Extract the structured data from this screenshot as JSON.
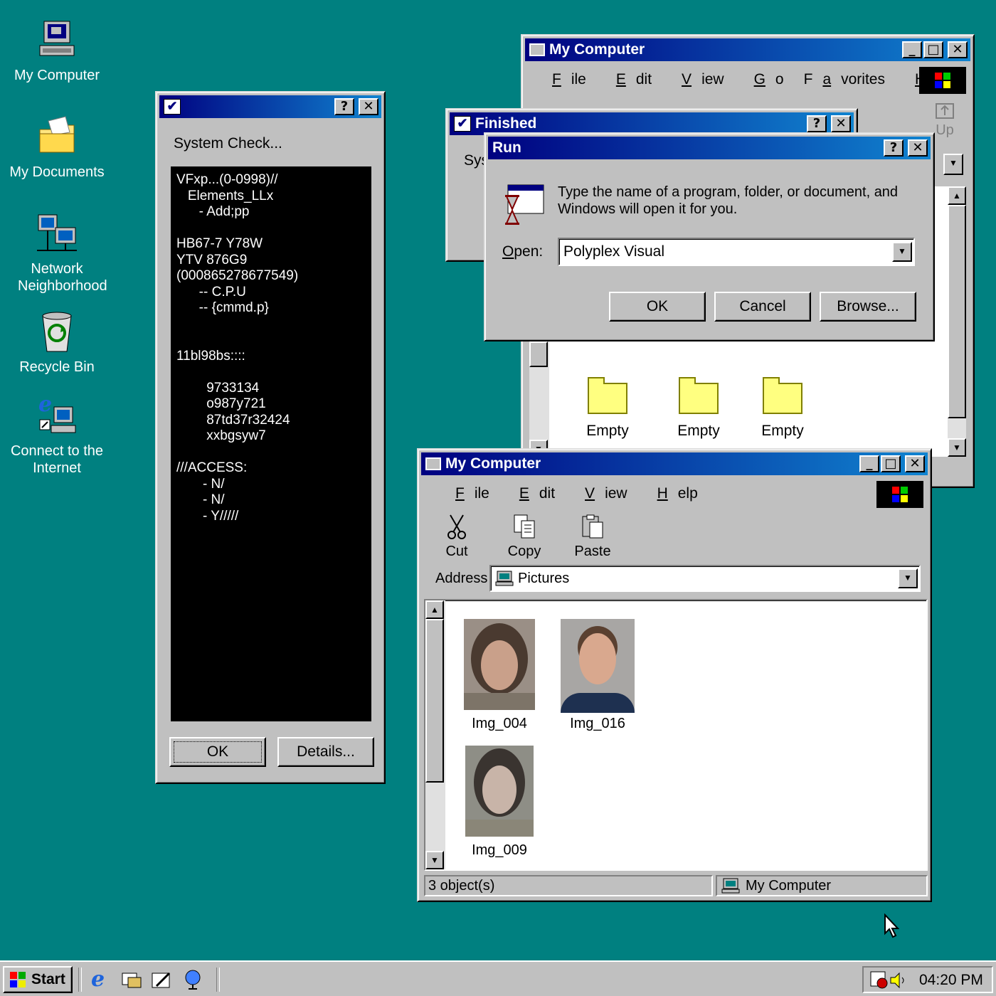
{
  "desktop": {
    "icons": [
      {
        "label": "My Computer"
      },
      {
        "label": "My Documents"
      },
      {
        "label": "Network Neighborhood"
      },
      {
        "label": "Recycle Bin"
      },
      {
        "label": "Connect to the Internet"
      }
    ]
  },
  "system_check": {
    "heading": "System Check...",
    "console_lines": [
      "VFxp...(0-0998)//",
      "   Elements_LLx",
      "      - Add;pp",
      "",
      "HB67-7 Y78W",
      "YTV 876G9",
      "(000865278677549)",
      "      -- C.P.U",
      "      -- {cmmd.p}",
      "",
      "",
      "11bl98bs::::",
      "",
      "        9733134",
      "        o987y721",
      "        87td37r32424",
      "        xxbgsyw7",
      "",
      "///ACCESS:",
      "       - N/",
      "       - N/",
      "       - Y/////"
    ],
    "ok_label": "OK",
    "details_label": "Details..."
  },
  "finished": {
    "title": "Finished",
    "body_partial": "Sys"
  },
  "run": {
    "title": "Run",
    "prompt_line1": "Type the name of a program, folder, or document, and",
    "prompt_line2": "Windows will open it for you.",
    "open_label": "Open:",
    "open_value": "Polyplex Visual",
    "ok_label": "OK",
    "cancel_label": "Cancel",
    "browse_label": "Browse..."
  },
  "mycomputer_back": {
    "title": "My Computer",
    "menu": [
      "File",
      "Edit",
      "View",
      "Go",
      "Favorites",
      "Help"
    ],
    "up_label": "Up",
    "folders": [
      {
        "label": "Empty"
      },
      {
        "label": "Empty"
      },
      {
        "label": "Empty"
      }
    ]
  },
  "mycomputer_front": {
    "title": "My Computer",
    "menu": [
      "File",
      "Edit",
      "View",
      "Help"
    ],
    "toolbar": {
      "cut": "Cut",
      "copy": "Copy",
      "paste": "Paste"
    },
    "address_label": "Address",
    "address_value": "Pictures",
    "files": [
      {
        "label": "Img_004"
      },
      {
        "label": "Img_016"
      },
      {
        "label": "Img_009"
      }
    ],
    "status_left": "3 object(s)",
    "status_right": "My Computer"
  },
  "taskbar": {
    "start_label": "Start",
    "clock": "04:20 PM"
  },
  "colors": {
    "desktop": "#008080",
    "title_active": "#000080",
    "face": "#c0c0c0",
    "folder": "#ffff80"
  }
}
